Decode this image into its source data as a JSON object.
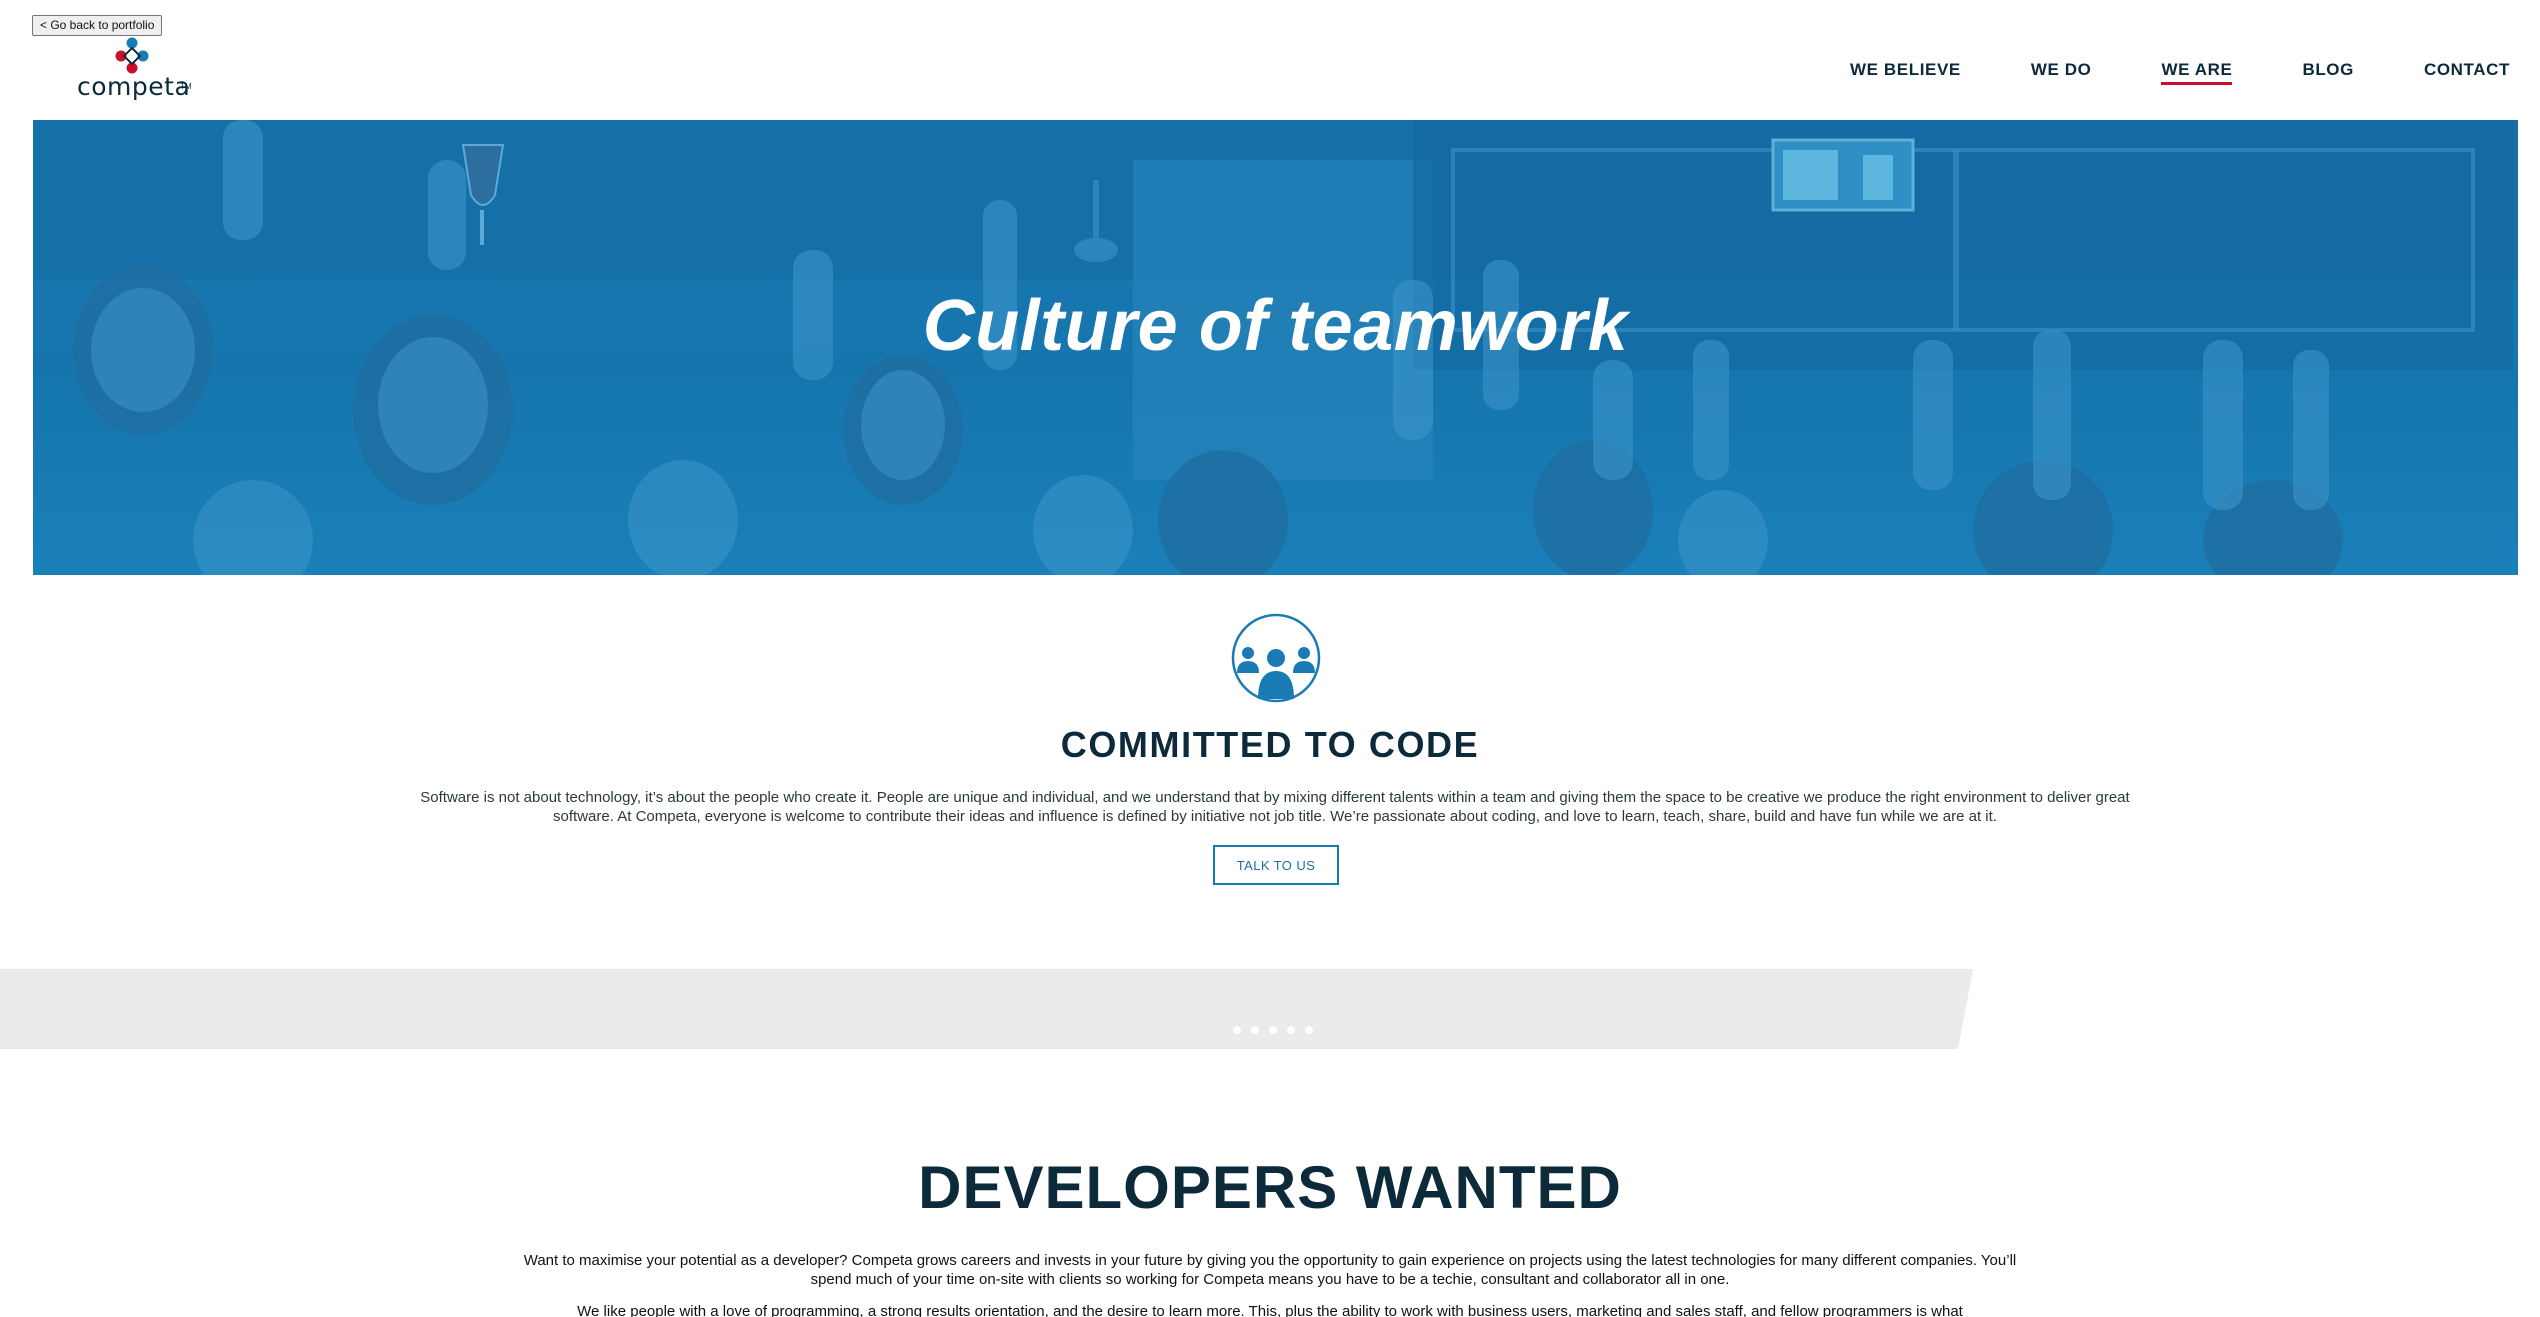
{
  "back_button": "< Go back to portfolio",
  "logo": {
    "text": "competa",
    "tm": "TM"
  },
  "nav": [
    {
      "label": "WE BELIEVE",
      "active": false
    },
    {
      "label": "WE DO",
      "active": false
    },
    {
      "label": "WE ARE",
      "active": true
    },
    {
      "label": "BLOG",
      "active": false
    },
    {
      "label": "CONTACT",
      "active": false
    }
  ],
  "hero": {
    "title": "Culture of teamwork"
  },
  "committed": {
    "icon": "team-people-icon",
    "title": "COMMITTED TO CODE",
    "body": "Software is not about technology, it’s about the people who create it. People are unique and individual, and we understand that by mixing different talents within a team and giving them the space to be creative we produce the right environment to deliver great software. At Competa, everyone is welcome to contribute their ideas and influence is defined by initiative not job title. We’re passionate about coding, and love to learn, teach, share, build and have fun while we are at it.",
    "button": "TALK TO US"
  },
  "slider": {
    "dot_count": 5
  },
  "developers": {
    "title": "DEVELOPERS WANTED",
    "p1": "Want to maximise your potential as a developer? Competa grows careers and invests in your future by giving you the opportunity to gain experience on projects using the latest technologies for many different companies. You’ll spend much of your time on-site with clients so working for Competa means you have to be a techie, consultant and collaborator all in one.",
    "p2": "We like people with a love of programming, a strong results orientation, and the desire to learn more. This, plus the ability to work with business users, marketing and sales staff, and fellow programmers is what"
  },
  "colors": {
    "brand_navy": "#0c2a3a",
    "brand_blue": "#1a7ab3",
    "accent_red": "#c8102e",
    "band_grey": "#ebebeb"
  }
}
